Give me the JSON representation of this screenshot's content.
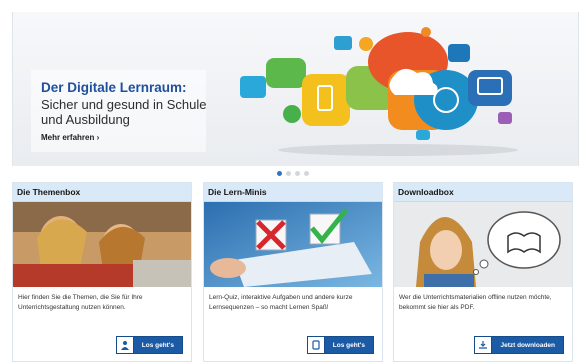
{
  "hero": {
    "title": "Der Digitale Lernraum:",
    "subtitle": "Sicher und gesund in Schule und Ausbildung",
    "more_link": "Mehr erfahren ›"
  },
  "carousel": {
    "active_index": 0,
    "count": 4
  },
  "cards": [
    {
      "title": "Die Themenbox",
      "text": "Hier finden Sie die Themen, die Sie für Ihre Unterrichtsgestaltung nutzen können.",
      "button": "Los geht's",
      "icon": "person-icon"
    },
    {
      "title": "Die Lern-Minis",
      "text": "Lern-Quiz, interaktive Aufgaben und andere kurze Lernsequenzen – so macht Lernen Spaß!",
      "button": "Los geht's",
      "icon": "tablet-icon"
    },
    {
      "title": "Downloadbox",
      "text": "Wer die Unterrichtsmaterialien offline nutzen möchte, bekommt sie hier als PDF.",
      "button": "Jetzt downloaden",
      "icon": "download-icon"
    }
  ],
  "colors": {
    "accent": "#1b5aa4",
    "title_blue": "#1f4f9d",
    "card_header": "#dae9f7"
  }
}
